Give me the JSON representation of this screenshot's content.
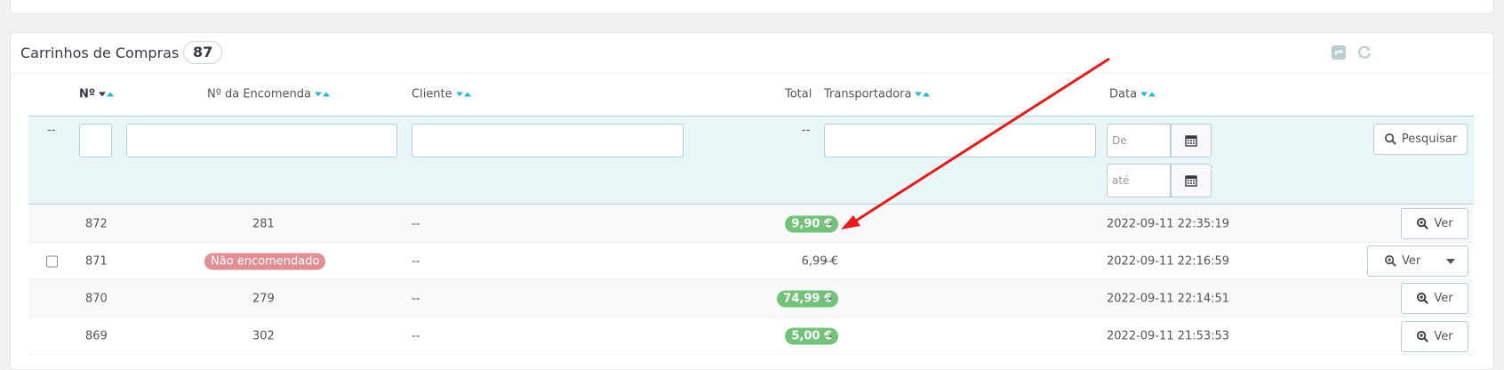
{
  "panel": {
    "title": "Carrinhos de Compras",
    "count": "87"
  },
  "columns": {
    "id": "Nº",
    "order": "Nº da Encomenda",
    "customer": "Cliente",
    "total": "Total",
    "carrier": "Transportadora",
    "date": "Data"
  },
  "filters": {
    "dash": "--",
    "date_from_placeholder": "De",
    "date_to_placeholder": "até",
    "search_label": "Pesquisar"
  },
  "rows": [
    {
      "id": "872",
      "order": "281",
      "customer": "--",
      "total": "9,90 €",
      "carrier": "--",
      "date": "2022-09-11 22:35:19",
      "action": "Ver"
    },
    {
      "id": "871",
      "order": "Não encomendado",
      "customer": "--",
      "total": "6,99 €",
      "carrier": "--",
      "date": "2022-09-11 22:16:59",
      "action": "Ver"
    },
    {
      "id": "870",
      "order": "279",
      "customer": "--",
      "total": "74,99 €",
      "carrier": "--",
      "date": "2022-09-11 22:14:51",
      "action": "Ver"
    },
    {
      "id": "869",
      "order": "302",
      "customer": "--",
      "total": "5,00 €",
      "carrier": "--",
      "date": "2022-09-11 21:53:53",
      "action": "Ver"
    }
  ],
  "colors": {
    "accent": "#25b9d7",
    "paid": "#72c279",
    "not_ordered": "#e08f95",
    "annotation_arrow": "#e8191b"
  },
  "icons": [
    "export-icon",
    "refresh-icon",
    "calendar-icon",
    "search-icon",
    "zoom-in-icon",
    "caret-down-icon"
  ]
}
